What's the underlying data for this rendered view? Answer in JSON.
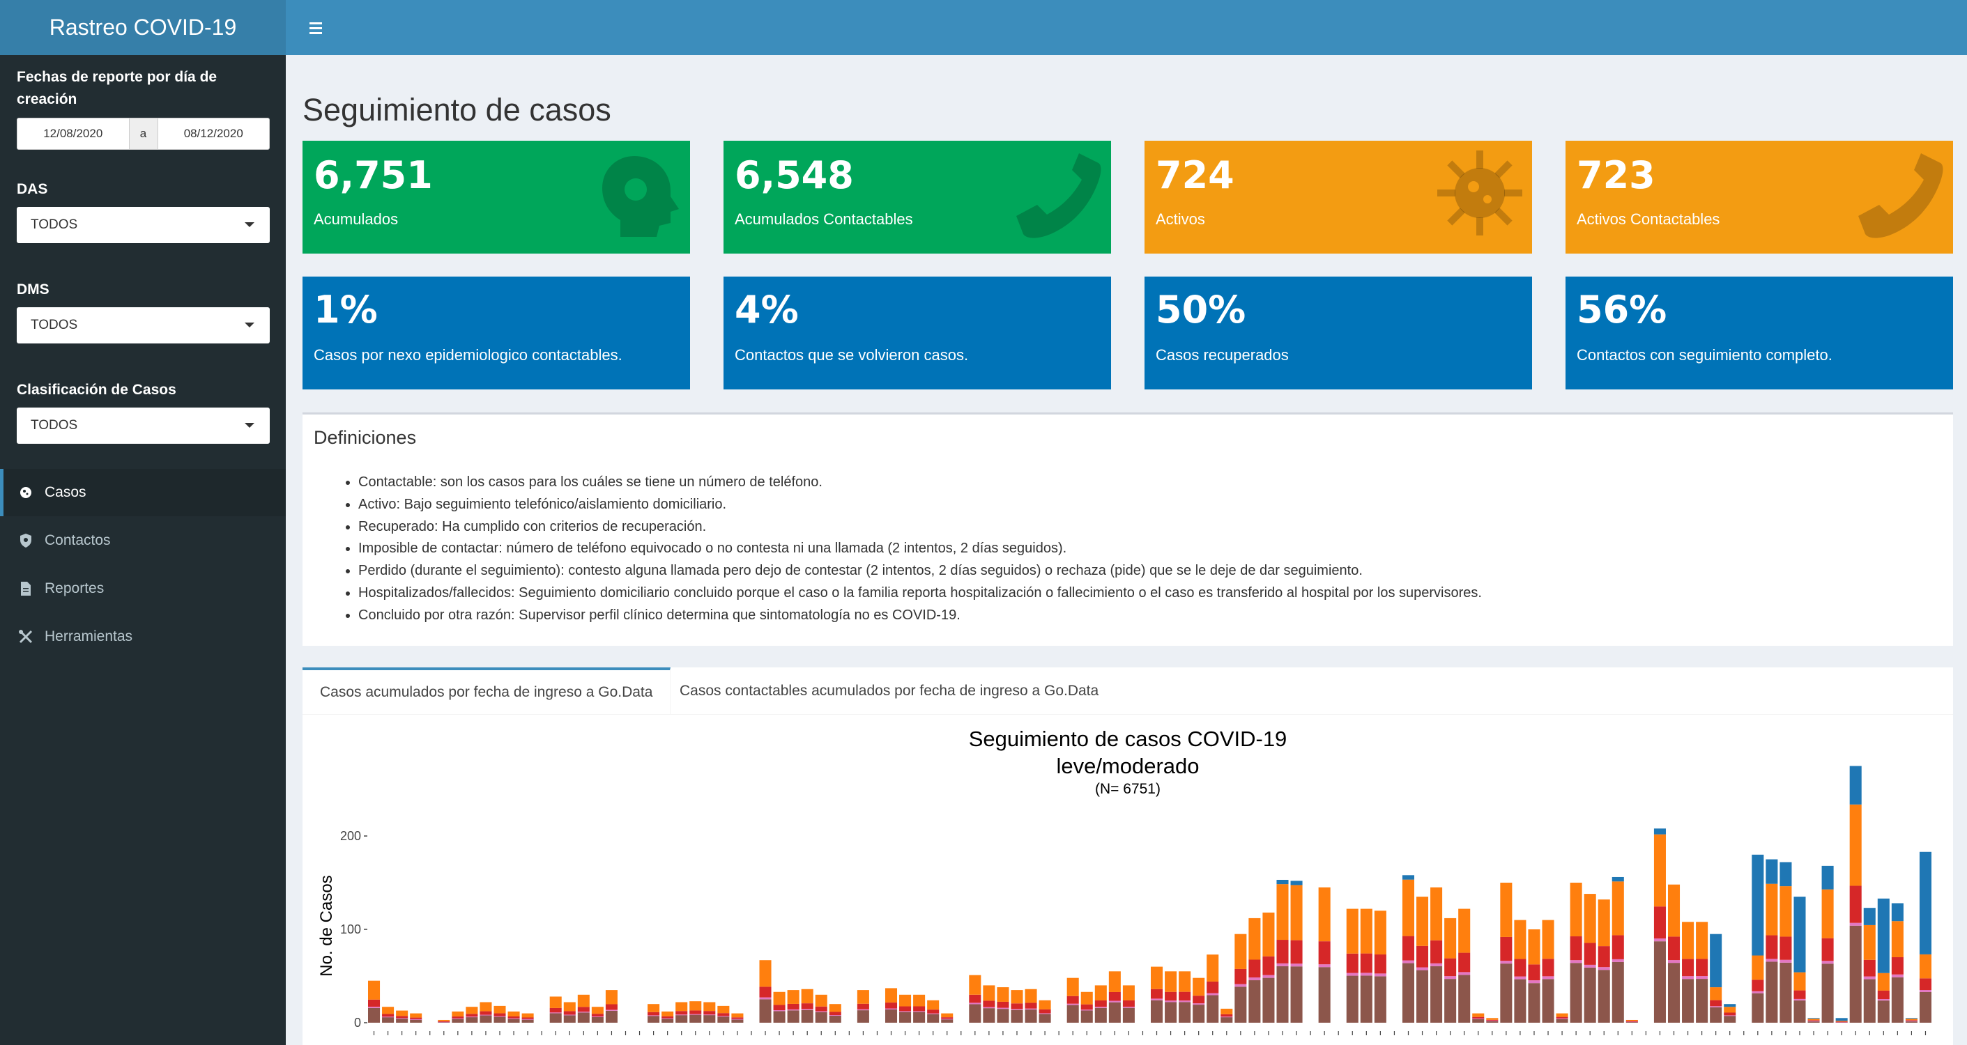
{
  "header": {
    "title": "Rastreo COVID-19"
  },
  "sidebar": {
    "date_label": "Fechas de reporte por día de creación",
    "date_from": "12/08/2020",
    "date_sep": "a",
    "date_to": "08/12/2020",
    "das_label": "DAS",
    "das_value": "TODOS",
    "dms_label": "DMS",
    "dms_value": "TODOS",
    "clasif_label": "Clasificación de Casos",
    "clasif_value": "TODOS",
    "menu": [
      "Casos",
      "Contactos",
      "Reportes",
      "Herramientas"
    ]
  },
  "page": {
    "title": "Seguimiento de casos"
  },
  "boxes": [
    {
      "value": "6,751",
      "label": "Acumulados",
      "icon": "head-virus-icon"
    },
    {
      "value": "6,548",
      "label": "Acumulados Contactables",
      "icon": "phone-icon"
    },
    {
      "value": "724",
      "label": "Activos",
      "icon": "virus-icon"
    },
    {
      "value": "723",
      "label": "Activos Contactables",
      "icon": "phone-icon"
    },
    {
      "value": "1%",
      "label": "Casos por nexo epidemiologico contactables."
    },
    {
      "value": "4%",
      "label": "Contactos que se volvieron casos."
    },
    {
      "value": "50%",
      "label": "Casos recuperados"
    },
    {
      "value": "56%",
      "label": "Contactos con seguimiento completo."
    }
  ],
  "colors": {
    "green": "#00a65a",
    "orange": "#f39c12",
    "blue": "#0073b7",
    "header": "#3c8dbc",
    "sidebar": "#222d32"
  },
  "definitions": {
    "title": "Definiciones",
    "items": [
      "Contactable: son los casos para los cuáles se tiene un número de teléfono.",
      "Activo: Bajo seguimiento telefónico/aislamiento domiciliario.",
      "Recuperado: Ha cumplido con criterios de recuperación.",
      "Imposible de contactar: número de teléfono equivocado o no contesta ni una llamada (2 intentos, 2 días seguidos).",
      "Perdido (durante el seguimiento): contesto alguna llamada pero dejo de contestar (2 intentos, 2 días seguidos) o rechaza (pide) que se le deje de dar seguimiento.",
      "Hospitalizados/fallecidos: Seguimiento domiciliario concluido porque el caso o la familia reporta hospitalización o fallecimiento o el caso es transferido al hospital por los supervisores.",
      "Concluido por otra razón: Supervisor perfil clínico determina que sintomatología no es COVID-19."
    ]
  },
  "tabs": [
    "Casos acumulados por fecha de ingreso a Go.Data",
    "Casos contactables acumulados por fecha de ingreso a Go.Data"
  ],
  "chart_data": {
    "type": "bar",
    "stacked": true,
    "title": "Seguimiento de casos COVID-19",
    "subtitle": "leve/moderado",
    "note": "(N= 6751)",
    "xlabel": "",
    "ylabel": "No. de Casos",
    "ylim": [
      0,
      280
    ],
    "yticks": [
      0,
      100,
      200
    ],
    "series_colors": [
      "#1f77b4",
      "#ff7f0e",
      "#d62728",
      "#8c564b",
      "#e377c2",
      "#bcbd22"
    ],
    "totals": [
      45,
      17,
      13,
      10,
      0,
      3,
      12,
      17,
      22,
      18,
      12,
      10,
      0,
      28,
      22,
      30,
      17,
      35,
      0,
      0,
      20,
      12,
      22,
      23,
      22,
      18,
      10,
      0,
      67,
      33,
      35,
      36,
      30,
      20,
      0,
      35,
      0,
      37,
      30,
      30,
      24,
      10,
      0,
      51,
      40,
      38,
      35,
      36,
      24,
      0,
      48,
      33,
      40,
      55,
      40,
      0,
      60,
      55,
      55,
      48,
      73,
      15,
      95,
      112,
      118,
      153,
      152,
      0,
      145,
      0,
      122,
      122,
      120,
      0,
      158,
      135,
      145,
      112,
      122,
      10,
      5,
      150,
      110,
      100,
      110,
      10,
      150,
      138,
      132,
      156,
      3,
      0,
      208,
      148,
      108,
      108,
      95,
      20,
      0,
      180,
      175,
      172,
      135,
      5,
      168,
      5,
      275,
      123,
      133,
      128,
      5,
      183
    ]
  }
}
